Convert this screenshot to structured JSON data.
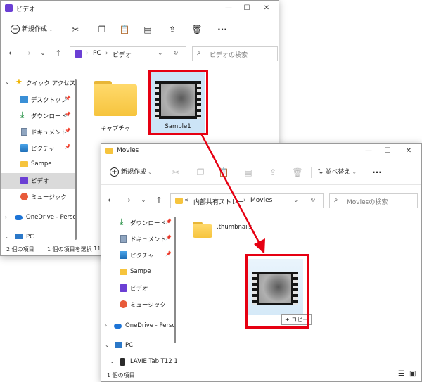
{
  "window1": {
    "title": "ビデオ",
    "toolbar": {
      "new_label": "新規作成"
    },
    "address": {
      "parts": [
        "PC",
        "ビデオ"
      ]
    },
    "search_placeholder": "ビデオの検索",
    "nav": {
      "quick_access": "クイック アクセス",
      "items": [
        "デスクトップ",
        "ダウンロード",
        "ドキュメント",
        "ピクチャ",
        "Sampe",
        "ビデオ",
        "ミュージック"
      ],
      "onedrive": "OneDrive - Perso",
      "pc": "PC"
    },
    "content": {
      "folder": "キャプチャ",
      "file": "Sample1"
    },
    "status": {
      "count": "2 個の項目",
      "selected": "1 個の項目を選択",
      "size": "11."
    }
  },
  "window2": {
    "title": "Movies",
    "toolbar": {
      "new_label": "新規作成",
      "sort_label": "並べ替え"
    },
    "address": {
      "prefix": "«",
      "parts": [
        "内部共有ストレー",
        "Movies"
      ]
    },
    "search_placeholder": "Moviesの検索",
    "nav": {
      "items": [
        "ダウンロード",
        "ドキュメント",
        "ピクチャ",
        "Sampe",
        "ビデオ",
        "ミュージック"
      ],
      "onedrive": "OneDrive - Perso",
      "pc": "PC",
      "device": "LAVIE Tab T12 1"
    },
    "content": {
      "folder": ".thumbnails",
      "copy_badge": "+ コピー"
    },
    "status": {
      "count": "1 個の項目"
    }
  },
  "colors": {
    "highlight": "#e60012",
    "folder": "#f6c43d",
    "accent": "#0067c0"
  }
}
